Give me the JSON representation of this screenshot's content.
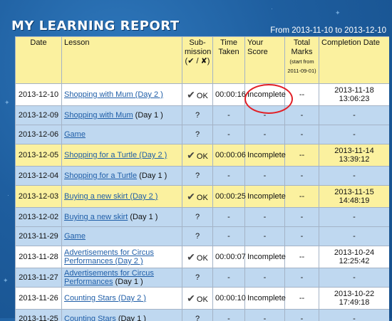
{
  "header": {
    "title": "MY LEARNING REPORT",
    "date_range": "From 2013-11-10 to 2013-12-10"
  },
  "columns": {
    "date": "Date",
    "lesson": "Lesson",
    "submission": "Sub-mission",
    "submission_legend": "(✔ / ✘)",
    "time_taken": "Time Taken",
    "your_score": "Your Score",
    "total_marks": "Total Marks",
    "total_marks_note": "(start from 2011-09-01)",
    "completion_date": "Completion Date"
  },
  "rows": [
    {
      "date": "2013-12-10",
      "lesson_link": "Shopping with Mum (Day 2 )",
      "lesson_extra": "",
      "submission": "OK",
      "checked": true,
      "time": "00:00:16",
      "score": "Incomplete",
      "marks": "--",
      "completion": "2013-11-18 13:06:23"
    },
    {
      "date": "2013-12-09",
      "lesson_link": "Shopping with Mum",
      "lesson_extra": " (Day 1 )",
      "submission": "?",
      "checked": false,
      "time": "-",
      "score": "-",
      "marks": "-",
      "completion": "-"
    },
    {
      "date": "2013-12-06",
      "lesson_link": "Game",
      "lesson_extra": "",
      "submission": "?",
      "checked": false,
      "time": "-",
      "score": "-",
      "marks": "-",
      "completion": "-"
    },
    {
      "date": "2013-12-05",
      "lesson_link": "Shopping for a Turtle (Day 2 )",
      "lesson_extra": "",
      "submission": "OK",
      "checked": true,
      "time": "00:00:06",
      "score": "Incomplete",
      "marks": "--",
      "completion": "2013-11-14 13:39:12"
    },
    {
      "date": "2013-12-04",
      "lesson_link": "Shopping for a Turtle",
      "lesson_extra": " (Day 1 )",
      "submission": "?",
      "checked": false,
      "time": "-",
      "score": "-",
      "marks": "-",
      "completion": "-"
    },
    {
      "date": "2013-12-03",
      "lesson_link": "Buying a new skirt (Day 2 )",
      "lesson_extra": "",
      "submission": "OK",
      "checked": true,
      "time": "00:00:25",
      "score": "Incomplete",
      "marks": "--",
      "completion": "2013-11-15 14:48:19"
    },
    {
      "date": "2013-12-02",
      "lesson_link": "Buying a new skirt",
      "lesson_extra": " (Day 1 )",
      "submission": "?",
      "checked": false,
      "time": "-",
      "score": "-",
      "marks": "-",
      "completion": "-"
    },
    {
      "date": "2013-11-29",
      "lesson_link": "Game",
      "lesson_extra": "",
      "submission": "?",
      "checked": false,
      "time": "-",
      "score": "-",
      "marks": "-",
      "completion": "-"
    },
    {
      "date": "2013-11-28",
      "lesson_link": "Advertisements for Circus Performances (Day 2 )",
      "lesson_extra": "",
      "submission": "OK",
      "checked": true,
      "time": "00:00:07",
      "score": "Incomplete",
      "marks": "--",
      "completion": "2013-10-24 12:25:42"
    },
    {
      "date": "2013-11-27",
      "lesson_link": "Advertisements for Circus Performances",
      "lesson_extra": " (Day 1 )",
      "submission": "?",
      "checked": false,
      "time": "-",
      "score": "-",
      "marks": "-",
      "completion": "-"
    },
    {
      "date": "2013-11-26",
      "lesson_link": "Counting Stars (Day 2 )",
      "lesson_extra": "",
      "submission": "OK",
      "checked": true,
      "time": "00:00:10",
      "score": "Incomplete",
      "marks": "--",
      "completion": "2013-10-22 17:49:18"
    },
    {
      "date": "2013-11-25",
      "lesson_link": "Counting Stars",
      "lesson_extra": " (Day 1 )",
      "submission": "?",
      "checked": false,
      "time": "-",
      "score": "-",
      "marks": "-",
      "completion": "-"
    }
  ],
  "row_styles": [
    "white",
    "blue",
    "blue",
    "yellow",
    "blue",
    "yellow",
    "blue",
    "blue",
    "white",
    "blue",
    "white",
    "blue"
  ],
  "colors": {
    "background": "#1e5e9f",
    "header_yellow": "#fbf19f",
    "row_blue": "#bfd8f0",
    "link_blue": "#1f5ea8",
    "highlight_red": "#e21f26"
  },
  "icons": {
    "check": "checkmark-icon"
  }
}
